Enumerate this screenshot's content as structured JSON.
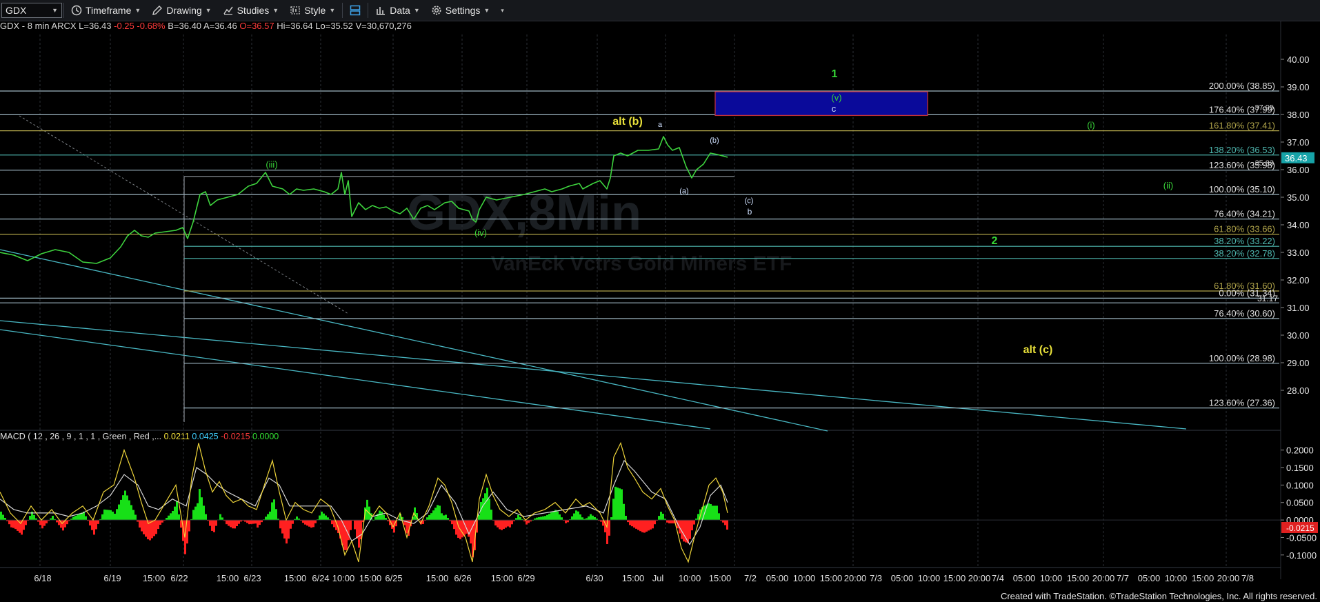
{
  "toolbar": {
    "symbol": "GDX",
    "timeframe": "Timeframe",
    "drawing": "Drawing",
    "studies": "Studies",
    "style": "Style",
    "data": "Data",
    "settings": "Settings"
  },
  "info": {
    "title": "GDX - 8 min  ARCX",
    "last": "L=36.43",
    "change": "-0.25",
    "change_pct": "-0.68%",
    "bid": "B=36.40",
    "ask": "A=36.46",
    "open": "O=36.57",
    "high": "Hi=36.64",
    "low": "Lo=35.52",
    "volume": "V=30,670,276"
  },
  "watermark": {
    "symbol": "GDX,8Min",
    "name": "VanEck Vctrs Gold Miners ETF"
  },
  "chart_data": {
    "type": "line",
    "price_axis": {
      "ylim": [
        26.6,
        40.9
      ],
      "ticks": [
        "40.00",
        "39.00",
        "38.00",
        "37.00",
        "36.00",
        "35.00",
        "34.00",
        "33.00",
        "32.00",
        "31.00",
        "30.00",
        "29.00",
        "28.00"
      ]
    },
    "last_price": "36.43",
    "x_labels": [
      "6/18",
      "6/19",
      "15:00",
      "6/22",
      "15:00",
      "6/23",
      "15:00",
      "6/24",
      "10:00",
      "15:00",
      "6/25",
      "15:00",
      "6/26",
      "15:00",
      "6/29",
      "6/30",
      "15:00",
      "Jul",
      "10:00",
      "15:00",
      "7/2",
      "05:00",
      "10:00",
      "15:00",
      "20:00",
      "7/3",
      "05:00",
      "10:00",
      "15:00",
      "20:00",
      "7/4",
      "05:00",
      "10:00",
      "15:00",
      "20:00",
      "7/7",
      "05:00",
      "10:00",
      "15:00",
      "20:00",
      "7/8"
    ],
    "price_series": [
      [
        0,
        33.0
      ],
      [
        20,
        32.9
      ],
      [
        40,
        32.7
      ],
      [
        60,
        32.95
      ],
      [
        80,
        33.1
      ],
      [
        100,
        33.0
      ],
      [
        120,
        32.65
      ],
      [
        140,
        32.6
      ],
      [
        160,
        32.8
      ],
      [
        175,
        33.2
      ],
      [
        185,
        33.6
      ],
      [
        195,
        33.8
      ],
      [
        205,
        33.6
      ],
      [
        215,
        33.55
      ],
      [
        225,
        33.7
      ],
      [
        240,
        33.75
      ],
      [
        255,
        33.8
      ],
      [
        265,
        33.9
      ],
      [
        272,
        33.5
      ],
      [
        280,
        34.1
      ],
      [
        290,
        35.1
      ],
      [
        298,
        35.2
      ],
      [
        305,
        34.7
      ],
      [
        315,
        34.9
      ],
      [
        330,
        35.0
      ],
      [
        345,
        35.1
      ],
      [
        360,
        35.4
      ],
      [
        372,
        35.5
      ],
      [
        385,
        35.9
      ],
      [
        395,
        35.4
      ],
      [
        410,
        35.3
      ],
      [
        420,
        35.1
      ],
      [
        430,
        35.3
      ],
      [
        440,
        35.25
      ],
      [
        455,
        35.3
      ],
      [
        470,
        35.2
      ],
      [
        480,
        35.1
      ],
      [
        490,
        35.3
      ],
      [
        495,
        35.9
      ],
      [
        500,
        35.1
      ],
      [
        505,
        35.6
      ],
      [
        510,
        34.3
      ],
      [
        520,
        34.8
      ],
      [
        530,
        34.55
      ],
      [
        540,
        34.7
      ],
      [
        550,
        34.6
      ],
      [
        560,
        34.65
      ],
      [
        570,
        34.5
      ],
      [
        580,
        34.4
      ],
      [
        590,
        34.6
      ],
      [
        600,
        34.2
      ],
      [
        610,
        34.6
      ],
      [
        620,
        34.7
      ],
      [
        630,
        34.55
      ],
      [
        645,
        34.8
      ],
      [
        655,
        34.85
      ],
      [
        665,
        34.6
      ],
      [
        680,
        34.5
      ],
      [
        685,
        34.2
      ],
      [
        690,
        34.1
      ],
      [
        695,
        34.55
      ],
      [
        705,
        35.0
      ],
      [
        720,
        34.9
      ],
      [
        740,
        35.0
      ],
      [
        760,
        35.1
      ],
      [
        775,
        35.2
      ],
      [
        790,
        35.3
      ],
      [
        800,
        35.2
      ],
      [
        815,
        35.3
      ],
      [
        825,
        35.4
      ],
      [
        840,
        35.5
      ],
      [
        845,
        35.3
      ],
      [
        860,
        35.5
      ],
      [
        870,
        35.6
      ],
      [
        880,
        35.3
      ],
      [
        885,
        35.7
      ],
      [
        890,
        36.5
      ],
      [
        900,
        36.6
      ],
      [
        910,
        36.5
      ],
      [
        925,
        36.7
      ],
      [
        940,
        36.7
      ],
      [
        955,
        36.75
      ],
      [
        962,
        37.2
      ],
      [
        968,
        36.9
      ],
      [
        975,
        36.7
      ],
      [
        985,
        36.8
      ],
      [
        995,
        36.1
      ],
      [
        1003,
        35.7
      ],
      [
        1010,
        36.0
      ],
      [
        1020,
        36.2
      ],
      [
        1030,
        36.6
      ],
      [
        1040,
        36.55
      ],
      [
        1055,
        36.45
      ]
    ],
    "macd": {
      "legend": {
        "name": "MACD ( 12 , 26 , 9 , 1 , 1 , Green , Red ,...",
        "macd": "0.0211",
        "avg": "0.0425",
        "diff": "-0.0215",
        "zero": "0.0000"
      },
      "ylim": [
        -0.13,
        0.225
      ],
      "ticks": [
        "0.2000",
        "0.1500",
        "0.1000",
        "0.0500",
        "0.0000",
        "-0.0500",
        "-0.1000"
      ],
      "value_tag": "-0.0215",
      "macd_series": [
        [
          0,
          0.08
        ],
        [
          15,
          0.02
        ],
        [
          30,
          -0.01
        ],
        [
          45,
          0.04
        ],
        [
          60,
          0.0
        ],
        [
          75,
          0.03
        ],
        [
          90,
          -0.01
        ],
        [
          105,
          0.02
        ],
        [
          120,
          0.04
        ],
        [
          135,
          0.0
        ],
        [
          150,
          0.08
        ],
        [
          165,
          0.1
        ],
        [
          180,
          0.2
        ],
        [
          195,
          0.12
        ],
        [
          205,
          0.05
        ],
        [
          215,
          -0.01
        ],
        [
          225,
          0.0
        ],
        [
          240,
          0.05
        ],
        [
          255,
          0.1
        ],
        [
          268,
          -0.05
        ],
        [
          278,
          0.12
        ],
        [
          288,
          0.22
        ],
        [
          298,
          0.14
        ],
        [
          308,
          0.08
        ],
        [
          318,
          0.11
        ],
        [
          328,
          0.07
        ],
        [
          338,
          0.05
        ],
        [
          350,
          0.06
        ],
        [
          360,
          0.04
        ],
        [
          372,
          0.03
        ],
        [
          385,
          0.11
        ],
        [
          395,
          0.17
        ],
        [
          405,
          0.08
        ],
        [
          415,
          0.0
        ],
        [
          428,
          0.05
        ],
        [
          440,
          0.03
        ],
        [
          452,
          0.02
        ],
        [
          465,
          0.06
        ],
        [
          478,
          0.04
        ],
        [
          490,
          -0.02
        ],
        [
          500,
          -0.1
        ],
        [
          510,
          -0.06
        ],
        [
          520,
          -0.12
        ],
        [
          530,
          0.03
        ],
        [
          540,
          0.01
        ],
        [
          550,
          0.04
        ],
        [
          560,
          0.02
        ],
        [
          570,
          -0.02
        ],
        [
          580,
          0.02
        ],
        [
          590,
          -0.05
        ],
        [
          600,
          0.02
        ],
        [
          610,
          -0.01
        ],
        [
          622,
          0.04
        ],
        [
          635,
          0.12
        ],
        [
          645,
          0.1
        ],
        [
          655,
          0.05
        ],
        [
          665,
          -0.02
        ],
        [
          675,
          -0.05
        ],
        [
          685,
          -0.12
        ],
        [
          695,
          0.06
        ],
        [
          705,
          0.13
        ],
        [
          715,
          0.07
        ],
        [
          725,
          0.03
        ],
        [
          738,
          0.01
        ],
        [
          750,
          0.03
        ],
        [
          762,
          0.0
        ],
        [
          775,
          0.02
        ],
        [
          790,
          0.03
        ],
        [
          805,
          0.05
        ],
        [
          820,
          0.02
        ],
        [
          835,
          0.06
        ],
        [
          845,
          0.04
        ],
        [
          855,
          0.05
        ],
        [
          870,
          0.02
        ],
        [
          880,
          -0.02
        ],
        [
          890,
          0.18
        ],
        [
          900,
          0.22
        ],
        [
          910,
          0.15
        ],
        [
          920,
          0.12
        ],
        [
          932,
          0.08
        ],
        [
          945,
          0.06
        ],
        [
          958,
          0.09
        ],
        [
          968,
          0.04
        ],
        [
          978,
          0.0
        ],
        [
          988,
          -0.08
        ],
        [
          998,
          -0.12
        ],
        [
          1008,
          -0.04
        ],
        [
          1018,
          0.03
        ],
        [
          1028,
          0.1
        ],
        [
          1038,
          0.12
        ],
        [
          1048,
          0.08
        ],
        [
          1055,
          0.02
        ]
      ],
      "avg_series": [
        [
          0,
          0.06
        ],
        [
          20,
          0.03
        ],
        [
          40,
          0.02
        ],
        [
          60,
          0.02
        ],
        [
          80,
          0.02
        ],
        [
          100,
          0.01
        ],
        [
          120,
          0.02
        ],
        [
          140,
          0.04
        ],
        [
          160,
          0.07
        ],
        [
          180,
          0.13
        ],
        [
          200,
          0.1
        ],
        [
          215,
          0.04
        ],
        [
          230,
          0.03
        ],
        [
          250,
          0.06
        ],
        [
          270,
          0.04
        ],
        [
          285,
          0.15
        ],
        [
          300,
          0.13
        ],
        [
          315,
          0.1
        ],
        [
          330,
          0.08
        ],
        [
          350,
          0.06
        ],
        [
          370,
          0.04
        ],
        [
          390,
          0.12
        ],
        [
          405,
          0.1
        ],
        [
          420,
          0.04
        ],
        [
          440,
          0.04
        ],
        [
          460,
          0.04
        ],
        [
          480,
          0.04
        ],
        [
          495,
          0.0
        ],
        [
          510,
          -0.06
        ],
        [
          525,
          -0.04
        ],
        [
          540,
          0.01
        ],
        [
          560,
          0.02
        ],
        [
          580,
          0.0
        ],
        [
          600,
          -0.01
        ],
        [
          620,
          0.02
        ],
        [
          640,
          0.1
        ],
        [
          660,
          0.05
        ],
        [
          680,
          -0.04
        ],
        [
          700,
          0.04
        ],
        [
          715,
          0.08
        ],
        [
          735,
          0.03
        ],
        [
          760,
          0.01
        ],
        [
          790,
          0.02
        ],
        [
          820,
          0.03
        ],
        [
          850,
          0.04
        ],
        [
          875,
          0.02
        ],
        [
          890,
          0.1
        ],
        [
          905,
          0.17
        ],
        [
          920,
          0.14
        ],
        [
          945,
          0.08
        ],
        [
          965,
          0.06
        ],
        [
          985,
          -0.02
        ],
        [
          1000,
          -0.07
        ],
        [
          1015,
          -0.02
        ],
        [
          1030,
          0.07
        ],
        [
          1045,
          0.1
        ],
        [
          1055,
          0.05
        ]
      ]
    },
    "fib_levels": [
      {
        "label": "200.00% (38.85)",
        "value": 38.85,
        "color": "#9fb8c4"
      },
      {
        "label": "176.40% (37.99)",
        "value": 37.99,
        "color": "#9fb8c4",
        "overlap": "37.95"
      },
      {
        "label": "161.80% (37.41)",
        "value": 37.41,
        "color": "#b0a44a"
      },
      {
        "label": "138.20% (36.53)",
        "value": 36.53,
        "color": "#4fb8b0"
      },
      {
        "label": "123.60% (35.98)",
        "value": 35.98,
        "color": "#9fb8c4",
        "overlap": "35.83"
      },
      {
        "label": "100.00% (35.10)",
        "value": 35.1,
        "color": "#9fb8c4"
      },
      {
        "label": "76.40% (34.21)",
        "value": 34.21,
        "color": "#9fb8c4"
      },
      {
        "label": "61.80% (33.66)",
        "value": 33.66,
        "color": "#b0a44a"
      },
      {
        "label": "38.20% (33.22)",
        "value": 33.22,
        "color": "#4fb8b0"
      },
      {
        "label": "38.20% (32.78)",
        "value": 32.78,
        "color": "#4fb8b0"
      },
      {
        "label": "61.80% (31.60)",
        "value": 31.6,
        "color": "#b0a44a"
      },
      {
        "label": "0.00% (31.34)",
        "value": 31.34,
        "color": "#9fb8c4"
      },
      {
        "label": "31.17",
        "value": 31.17,
        "color": "#9fb8c4"
      },
      {
        "label": "76.40% (30.60)",
        "value": 30.6,
        "color": "#9fb8c4"
      },
      {
        "label": "100.00% (28.98)",
        "value": 28.98,
        "color": "#9fb8c4"
      },
      {
        "label": "123.60% (27.36)",
        "value": 27.36,
        "color": "#9fb8c4"
      }
    ],
    "wave_labels": [
      {
        "text": "1",
        "color": "#36d836",
        "bold": true
      },
      {
        "text": "(v)",
        "color": "#39d439"
      },
      {
        "text": "c",
        "color": "#cfe0ff"
      },
      {
        "text": "alt (b)",
        "color": "#e8e03a",
        "bold": true
      },
      {
        "text": "a",
        "color": "#cfe0ff"
      },
      {
        "text": "(b)",
        "color": "#cfe0ff"
      },
      {
        "text": "(i)",
        "color": "#39d439"
      },
      {
        "text": "(iii)",
        "color": "#39d439"
      },
      {
        "text": "(a)",
        "color": "#cfe0ff"
      },
      {
        "text": "(ii)",
        "color": "#39d439"
      },
      {
        "text": "(c)",
        "color": "#cfe0ff"
      },
      {
        "text": "b",
        "color": "#cfe0ff"
      },
      {
        "text": "(iv)",
        "color": "#39d439"
      },
      {
        "text": "2",
        "color": "#36d836",
        "bold": true
      },
      {
        "text": "alt (c)",
        "color": "#e8e03a",
        "bold": true
      }
    ]
  },
  "footer": "Created with TradeStation. ©TradeStation Technologies, Inc. All rights reserved."
}
